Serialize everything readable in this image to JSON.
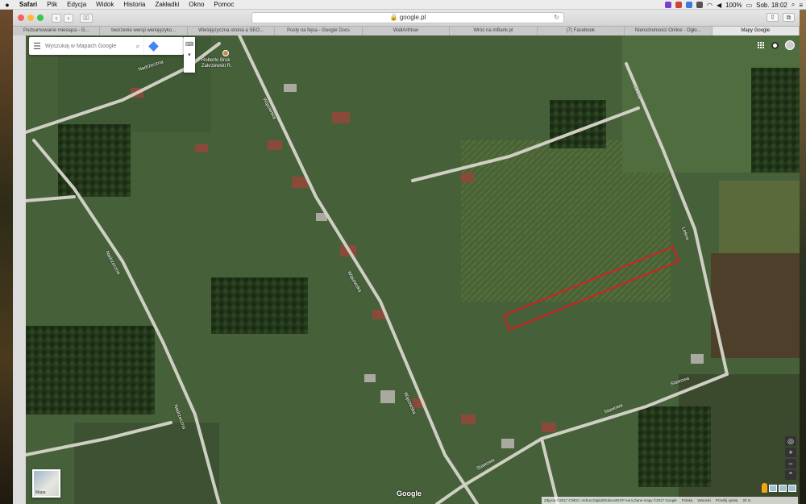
{
  "menubar": {
    "items": [
      "Safari",
      "Plik",
      "Edycja",
      "Widok",
      "Historia",
      "Zakładki",
      "Okno",
      "Pomoc"
    ],
    "battery": "100%",
    "clock": "Sob. 18:02"
  },
  "browser": {
    "url": "google.pl",
    "tabs": [
      "Podsumowanie miesiąca - G...",
      "tworzenie wersji wielojęzyko...",
      "Wielojęzyczna strona a SEO...",
      "Posty na fejsa - Google Docs",
      "WallArtNow",
      "Wróć na mBank.pl",
      "(7) Facebook",
      "Nieruchomości Online - Ogło...",
      "Mapy Google"
    ],
    "active_tab": 8
  },
  "map": {
    "search_placeholder": "Wyszukaj w Mapach Google",
    "poi_name_line1": "Roberto Bruk",
    "poi_name_line2": "Zakrzewski R.",
    "streets": {
      "nadrzeczna": "Nadrzeczna",
      "wasowska": "Wąsowska",
      "lesna": "Leśna",
      "stawowa": "Stawowa"
    },
    "minimap_label": "Mapa",
    "google_logo": "Google",
    "attribution": {
      "imagery": "Zdjęcia ©2017 CNES / Airbus,DigitalGlobe,MGGP Aero,Dane mapy ©2017 Google",
      "country": "Polska",
      "terms": "Warunki",
      "feedback": "Prześlij opinię",
      "scale": "20 m"
    },
    "colors": {
      "highlight": "#d62020",
      "road": "#cfcfc4"
    }
  }
}
